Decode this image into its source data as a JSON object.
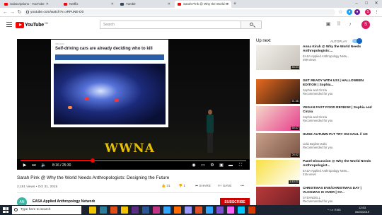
{
  "browser": {
    "tabs": [
      {
        "label": "Subscriptions - YouTube",
        "active": false,
        "favicon_color": "#ff0000"
      },
      {
        "label": "Netflix",
        "active": false,
        "favicon_color": "#e50914"
      },
      {
        "label": "Tumblr",
        "active": false,
        "favicon_color": "#35465c"
      },
      {
        "label": "Sarah Pink @ Why the World N",
        "active": true,
        "favicon_color": "#ff0000"
      }
    ],
    "new_tab": "+",
    "url": "youtube.com/watch?v=xRPuNE-D0",
    "window_controls": [
      "–",
      "□",
      "✕"
    ]
  },
  "youtube": {
    "logo_text": "YouTube",
    "logo_region": "GB",
    "search_placeholder": "Search",
    "avatar_letter": "S",
    "accent": "#ff0000"
  },
  "player": {
    "slide_title": "Self-driving cars are already deciding who to kill",
    "slide_brand": "VOX.com",
    "stage_text": "WWNA",
    "time": "8:16 / 25:30",
    "progress": 0.32
  },
  "video": {
    "title": "Sarah Pink @ Why the World Needs Anthropologists: Designing the Future",
    "meta": "2,181 views • Oct 31, 2018",
    "likes": "31",
    "dislikes": "1",
    "share": "SHARE",
    "save": "SAVE",
    "more": "•••",
    "channel": "EASA Applied Anthropology Network",
    "channel_initials": "AN",
    "subscribe": "SUBSCRIBE"
  },
  "sidebar": {
    "up_next": "Up next",
    "autoplay": "AUTOPLAY",
    "items": [
      {
        "title": "Anna Kirah @ Why the World Needs Anthropologists:...",
        "channel": "EASA Applied Anthropology Netw...",
        "info": "499 views",
        "duration": "46:04",
        "colors": [
          "#f2f0ec",
          "#c7c2b8"
        ]
      },
      {
        "title": "GET READY WITH US! | HALLOWEEN EDITION | Sophia...",
        "channel": "Sophia and Cinzia",
        "info": "Recommended for you",
        "duration": "51:36",
        "colors": [
          "#e66a1e",
          "#2b1a14"
        ]
      },
      {
        "title": "VEGAN FAST FOOD REVIEW! | Sophia and Cinzia",
        "channel": "Sophia and Cinzia",
        "info": "Recommended for you",
        "duration": "50:47",
        "colors": [
          "#f3d6c9",
          "#e83e8c"
        ]
      },
      {
        "title": "HUGE AUTUMN PLT TRY ON HAUL // AD",
        "channel": "Lidia Bayliss-Zullo",
        "info": "Recommended for you",
        "duration": "26:02",
        "colors": [
          "#c8a08a",
          "#7a5444"
        ]
      },
      {
        "title": "Panel Discussion @ Why the World Needs Anthropologist...",
        "channel": "EASA Applied Anthropology Netw...",
        "info": "315 views",
        "duration": "1:10:21",
        "colors": [
          "#f8e043",
          "#ffffff"
        ]
      },
      {
        "title": "CHRISTMAS EVE/CHRISTMAS DAY | VLOGMAS IS OVER | SY...",
        "channel": "SYDANDELL",
        "info": "Recommended for you",
        "duration": "",
        "colors": [
          "#b83a3a",
          "#6b1d24"
        ]
      }
    ]
  },
  "taskbar": {
    "search_placeholder": "Type here to search",
    "tray": "^ ⌂ ◐ ENG",
    "time": "12:53",
    "date": "05/02/2019",
    "app_colors": [
      "#f0c400",
      "#2d7d9a",
      "#e04e16",
      "#f0c400",
      "#5a2d82",
      "#2b5797",
      "#c13584",
      "#31a8ff",
      "#ff6a00",
      "#9999ff",
      "#e34f26",
      "#31a8ff",
      "#7a4fd0",
      "#ff61f6",
      "#00c8ff",
      "#d83b01"
    ]
  }
}
